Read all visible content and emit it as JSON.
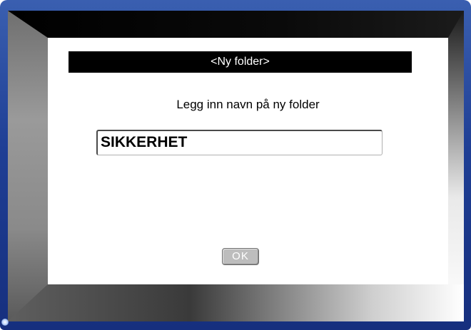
{
  "dialog": {
    "title": "<Ny folder>",
    "prompt": "Legg inn navn på ny folder",
    "folder_name_value": "SIKKERHET",
    "ok_label": "OK"
  },
  "colors": {
    "device_frame": "#1f3f95",
    "title_bar_background": "#000000",
    "title_bar_text": "#ffffff",
    "dialog_background": "#ffffff",
    "ok_button_background": "#bdbdbd"
  }
}
